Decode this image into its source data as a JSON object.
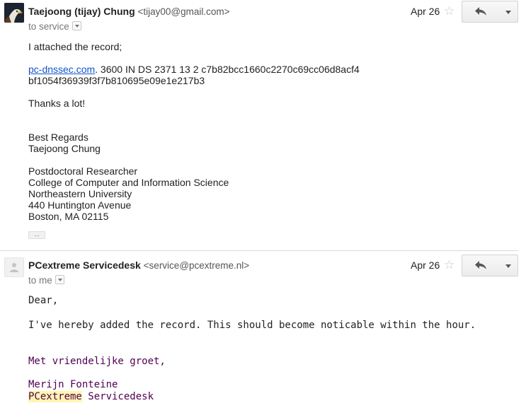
{
  "thread": [
    {
      "sender_name": "Taejoong (tijay) Chung",
      "sender_email": "<tijay00@gmail.com>",
      "to_line": "to service",
      "date": "Apr 26",
      "body": {
        "intro": "I attached the record;",
        "record_link": "pc-dnssec.com",
        "record_rest": ". 3600 IN DS 2371 13 2 c7b82bcc1660c2270c69cc06d8acf4",
        "record_line2": "bf1054f36939f3f7b810695e09e1e217b3",
        "thanks": "Thanks a lot!",
        "closing": "Best Regards",
        "signer": "Taejoong Chung",
        "title": "Postdoctoral Researcher",
        "college": "College of Computer and Information Science",
        "university": "Northeastern University",
        "street": "440 Huntington Avenue",
        "city": "Boston, MA 02115"
      },
      "trimmed_content_label": "..."
    },
    {
      "sender_name": "PCextreme Servicedesk",
      "sender_email": "<service@pcextreme.nl>",
      "to_line": "to me",
      "date": "Apr 26",
      "body": {
        "greeting": "Dear,",
        "message": "I've hereby added the record. This should become noticable within the hour.",
        "closing": "Met vriendelijke groet,",
        "signer": "Merijn Fonteine",
        "company_highlight": "PCextreme",
        "company_rest": " Servicedesk"
      }
    }
  ],
  "icons": {
    "star": "star-icon",
    "reply": "reply-arrow-icon",
    "more": "chevron-down-icon",
    "details": "dropdown-details-icon"
  },
  "colors": {
    "link": "#1155cc",
    "signature": "#500050",
    "highlight": "#fff5b0"
  }
}
